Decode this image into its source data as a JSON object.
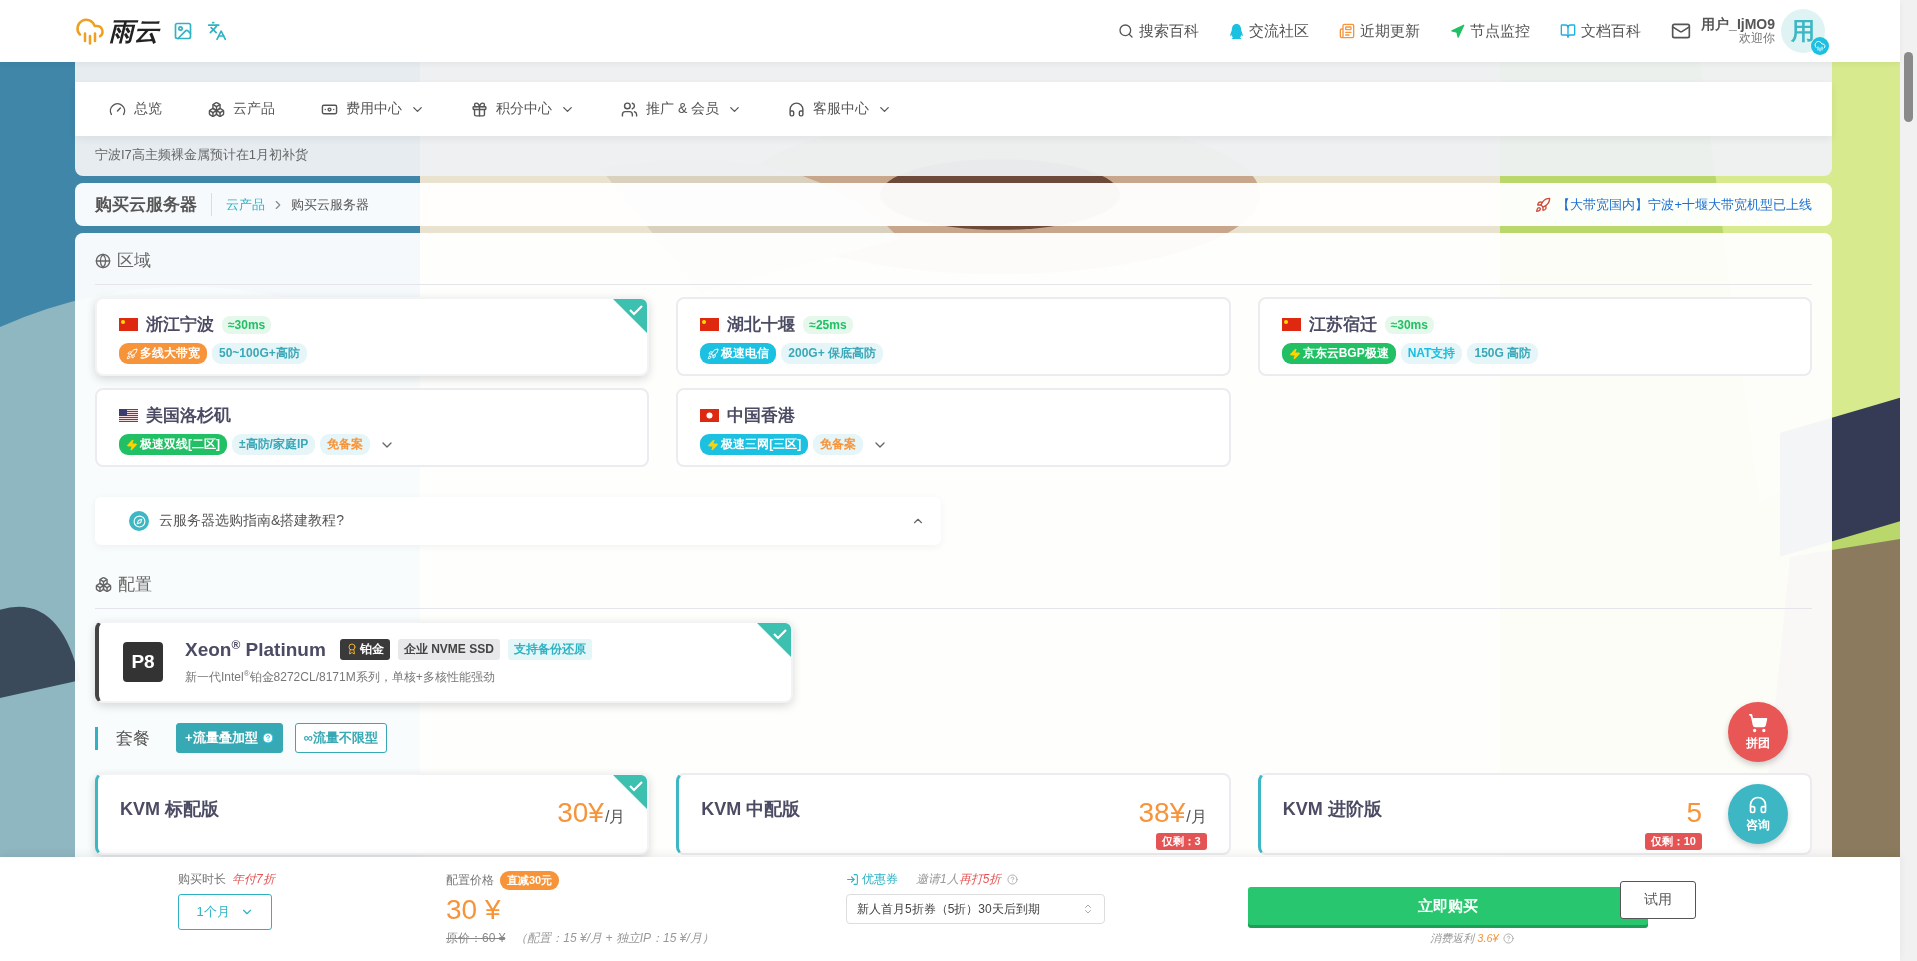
{
  "header": {
    "logo_text": "雨云",
    "nav": [
      {
        "label": "搜索百科"
      },
      {
        "label": "交流社区"
      },
      {
        "label": "近期更新"
      },
      {
        "label": "节点监控"
      },
      {
        "label": "文档百科"
      }
    ],
    "user": {
      "name": "用户_IjMO9",
      "greeting": "欢迎你",
      "avatar_text": "用"
    }
  },
  "menu": [
    {
      "label": "总览",
      "dropdown": false
    },
    {
      "label": "云产品",
      "dropdown": false
    },
    {
      "label": "费用中心",
      "dropdown": true
    },
    {
      "label": "积分中心",
      "dropdown": true
    },
    {
      "label": "推广 & 会员",
      "dropdown": true
    },
    {
      "label": "客服中心",
      "dropdown": true
    }
  ],
  "notice": "宁波I7高主频裸金属预计在1月初补货",
  "breadcrumb": {
    "title": "购买云服务器",
    "crumbs": [
      "云产品",
      "购买云服务器"
    ],
    "announcement": "【大带宽国内】宁波+十堰大带宽机型已上线"
  },
  "region_section": {
    "title": "区域",
    "regions": [
      {
        "name": "浙江宁波",
        "kind": "cn",
        "latency": "≈30ms",
        "selected": true,
        "expandable": false,
        "tags": [
          {
            "text": "多线大带宽",
            "kind": "rocket",
            "solid": true,
            "color": "#f7943a"
          },
          {
            "text": "50~100G+高防",
            "kind": "plain",
            "solid": false,
            "color": "#3aa8b8"
          }
        ]
      },
      {
        "name": "湖北十堰",
        "kind": "cn",
        "latency": "≈25ms",
        "selected": false,
        "expandable": false,
        "tags": [
          {
            "text": "极速电信",
            "kind": "rocket",
            "solid": true,
            "color": "#1cc0e0"
          },
          {
            "text": "200G+ 保底高防",
            "kind": "plain",
            "solid": false,
            "color": "#3aa8b8"
          }
        ]
      },
      {
        "name": "江苏宿迁",
        "kind": "cn",
        "latency": "≈30ms",
        "selected": false,
        "expandable": false,
        "tags": [
          {
            "text": "京东云BGP极速",
            "kind": "bolt",
            "solid": true,
            "color": "#22c064"
          },
          {
            "text": "NAT支持",
            "kind": "plain",
            "solid": false,
            "color": "#18bfe0"
          },
          {
            "text": "150G 高防",
            "kind": "plain",
            "solid": false,
            "color": "#3aa8b8"
          }
        ]
      },
      {
        "name": "美国洛杉矶",
        "kind": "us",
        "selected": false,
        "expandable": true,
        "tags": [
          {
            "text": "极速双线[二区]",
            "kind": "bolt",
            "solid": true,
            "color": "#22c064"
          },
          {
            "text": "±高防/家庭IP",
            "kind": "plain",
            "solid": false,
            "color": "#3aa8b8"
          },
          {
            "text": "免备案",
            "kind": "plain",
            "solid": false,
            "color": "#f7943a"
          }
        ]
      },
      {
        "name": "中国香港",
        "kind": "hk",
        "selected": false,
        "expandable": true,
        "tags": [
          {
            "text": "极速三网[三区]",
            "kind": "bolt",
            "solid": true,
            "color": "#1cc0e0"
          },
          {
            "text": "免备案",
            "kind": "plain",
            "solid": false,
            "color": "#f7943a"
          }
        ]
      }
    ]
  },
  "guide": {
    "label": "云服务器选购指南&搭建教程?"
  },
  "config_section": {
    "title": "配置",
    "configs": [
      {
        "badge": "P8",
        "title": "Xeon$^{®}$ Platinum",
        "selected": true,
        "description": "新一代Intel$^{®}$铂金8272CL/8171M系列，单核+多核性能强劲",
        "tags": [
          {
            "text": "铂金",
            "kind": "medal"
          },
          {
            "text": "企业 NVME SSD",
            "kind": "grey"
          },
          {
            "text": "支持备份还原",
            "kind": "soft"
          }
        ]
      }
    ]
  },
  "plan_section": {
    "title": "套餐",
    "plan_types": [
      {
        "label": "+流量叠加型",
        "selected": true,
        "help": true
      },
      {
        "label": "∞流量不限型",
        "selected": false,
        "help": false
      }
    ],
    "packages": [
      {
        "name": "KVM 标配版",
        "price": "30¥",
        "unit": "/月",
        "selected": true
      },
      {
        "name": "KVM 中配版",
        "price": "38¥",
        "unit": "/月",
        "stock": "仅剩：3",
        "selected": false
      },
      {
        "name": "KVM 进阶版",
        "price": "5",
        "stock": "仅剩：10",
        "selected": false
      }
    ]
  },
  "bottom_bar": {
    "duration": {
      "label": "购买时长",
      "discount": "年付7折",
      "value": "1个月"
    },
    "price": {
      "label": "配置价格",
      "badge": "直减30元",
      "amount": "30 ¥",
      "original": "原价：60 ¥",
      "breakdown": "（配置：15 ¥/月 + 独立IP：15 ¥/月）"
    },
    "coupon": {
      "label": "优惠券",
      "invite": "邀请1人",
      "invite_bonus": "再打5折",
      "value": "新人首月5折券（5折）30天后到期"
    },
    "buy_button": "立即购买",
    "trial_button": "试用",
    "rebate": {
      "label": "消费返利",
      "amount": "3.6¥"
    }
  },
  "float_buttons": [
    {
      "label": "拼团",
      "kind": "cart"
    },
    {
      "label": "咨询",
      "kind": "support"
    }
  ]
}
